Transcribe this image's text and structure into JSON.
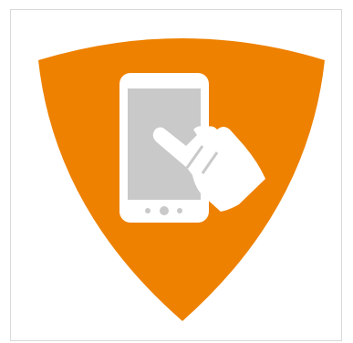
{
  "icon": {
    "name": "touch-smartphone-shield-icon",
    "shield_color": "#EE8100",
    "phone_color": "#ffffff",
    "screen_color": "#c9c9c9"
  }
}
